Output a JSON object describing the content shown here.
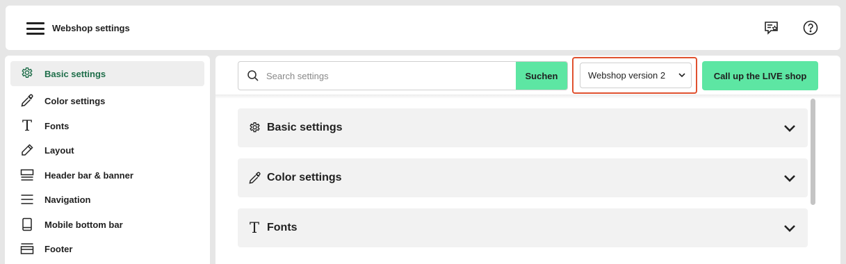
{
  "header": {
    "title": "Webshop settings",
    "icons": [
      "menu-icon",
      "feedback-icon",
      "help-icon"
    ]
  },
  "sidebar": {
    "items": [
      {
        "label": "Basic settings",
        "icon": "gear-icon",
        "active": true
      },
      {
        "label": "Color settings",
        "icon": "color-picker-icon",
        "active": false
      },
      {
        "label": "Fonts",
        "icon": "font-icon",
        "active": false
      },
      {
        "label": "Layout",
        "icon": "pencil-icon",
        "active": false
      },
      {
        "label": "Header bar & banner",
        "icon": "header-bar-icon",
        "active": false
      },
      {
        "label": "Navigation",
        "icon": "list-icon",
        "active": false
      },
      {
        "label": "Mobile bottom bar",
        "icon": "mobile-icon",
        "active": false
      },
      {
        "label": "Footer",
        "icon": "footer-icon",
        "active": false
      }
    ]
  },
  "toolbar": {
    "search_placeholder": "Search settings",
    "search_button": "Suchen",
    "version_select": "Webshop version 2",
    "live_button": "Call up the LIVE shop"
  },
  "sections": [
    {
      "label": "Basic settings",
      "icon": "gear-icon"
    },
    {
      "label": "Color settings",
      "icon": "color-picker-icon"
    },
    {
      "label": "Fonts",
      "icon": "font-icon"
    }
  ],
  "colors": {
    "accent": "#5de6a3",
    "active_text": "#1f6e4a",
    "highlight_border": "#e0512f"
  }
}
